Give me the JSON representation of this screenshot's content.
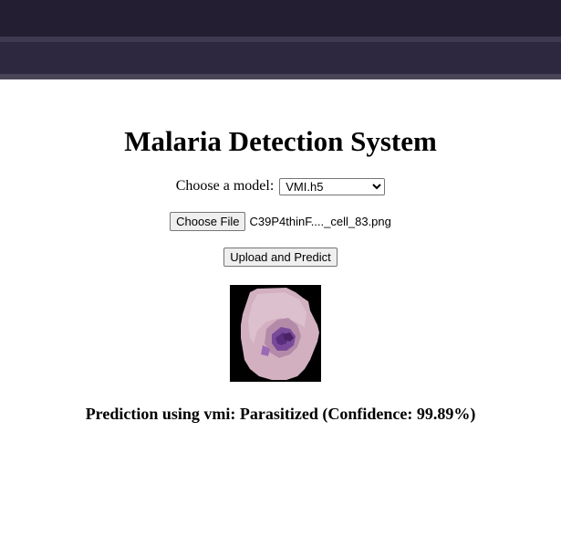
{
  "page": {
    "title": "Malaria Detection System"
  },
  "model_select": {
    "label": "Choose a model:",
    "selected": "VMI.h5"
  },
  "file_input": {
    "button_label": "Choose File",
    "file_name": "C39P4thinF...._cell_83.png"
  },
  "upload": {
    "button_label": "Upload and Predict"
  },
  "result": {
    "text": "Prediction using vmi: Parasitized (Confidence: 99.89%)"
  },
  "colors": {
    "header_bg": "#231d33",
    "header_stripe": "#3e3850",
    "cell_pink": "#d4b3c3",
    "cell_purple": "#6b3a8a",
    "page_bg": "#ffffff"
  }
}
